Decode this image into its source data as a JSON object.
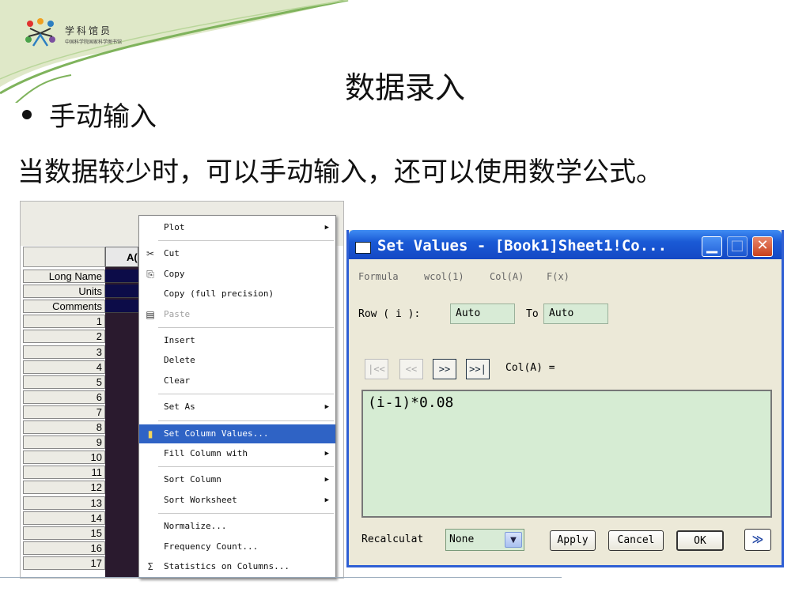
{
  "logo": {
    "title": "学科馆员",
    "subtitle": "中国科学院国家科学图书馆"
  },
  "slide": {
    "title": "数据录入",
    "bullet": "手动输入",
    "description": "当数据较少时，可以手动输入，还可以使用数学公式。"
  },
  "worksheet": {
    "column_header": "A(",
    "row_labels": [
      "Long Name",
      "Units",
      "Comments",
      "1",
      "2",
      "3",
      "4",
      "5",
      "6",
      "7",
      "8",
      "9",
      "10",
      "11",
      "12",
      "13",
      "14",
      "15",
      "16",
      "17"
    ]
  },
  "context_menu": {
    "items": [
      {
        "label": "Plot",
        "submenu": true
      },
      {
        "sep": true
      },
      {
        "label": "Cut",
        "icon": "scissors-icon",
        "glyph": "✂"
      },
      {
        "label": "Copy",
        "icon": "copy-icon",
        "glyph": "⎘"
      },
      {
        "label": "Copy (full precision)"
      },
      {
        "label": "Paste",
        "icon": "paste-icon",
        "glyph": "▤",
        "disabled": true
      },
      {
        "sep": true
      },
      {
        "label": "Insert"
      },
      {
        "label": "Delete"
      },
      {
        "label": "Clear"
      },
      {
        "sep": true
      },
      {
        "label": "Set As",
        "submenu": true
      },
      {
        "sep": true
      },
      {
        "label": "Set Column Values...",
        "icon": "set-values-icon",
        "glyph": "▮",
        "highlight": true
      },
      {
        "label": "Fill Column with",
        "submenu": true
      },
      {
        "sep": true
      },
      {
        "label": "Sort Column",
        "submenu": true
      },
      {
        "label": "Sort Worksheet",
        "submenu": true
      },
      {
        "sep": true
      },
      {
        "label": "Normalize..."
      },
      {
        "label": "Frequency Count..."
      },
      {
        "label": "Statistics on Columns...",
        "icon": "sigma-icon",
        "glyph": "Σ"
      }
    ]
  },
  "dialog": {
    "title": "Set Values - [Book1]Sheet1!Co...",
    "menu": [
      "Formula",
      "wcol(1)",
      "Col(A)",
      "F(x)"
    ],
    "row_label": "Row ( i ):",
    "row_from": "Auto",
    "to_label": "To",
    "row_to": "Auto",
    "nav": [
      "|<<",
      "<<",
      ">>",
      ">>|"
    ],
    "col_label": "Col(A) =",
    "formula": "(i-1)*0.08",
    "recalculate_label": "Recalculat",
    "recalculate_value": "None",
    "buttons": {
      "apply": "Apply",
      "cancel": "Cancel",
      "ok": "OK"
    }
  },
  "colors": {
    "title_bar": "#1a5ad6",
    "highlight": "#2f63c5",
    "field_bg": "#d6ecd3",
    "header_green": "#7fb35c"
  }
}
